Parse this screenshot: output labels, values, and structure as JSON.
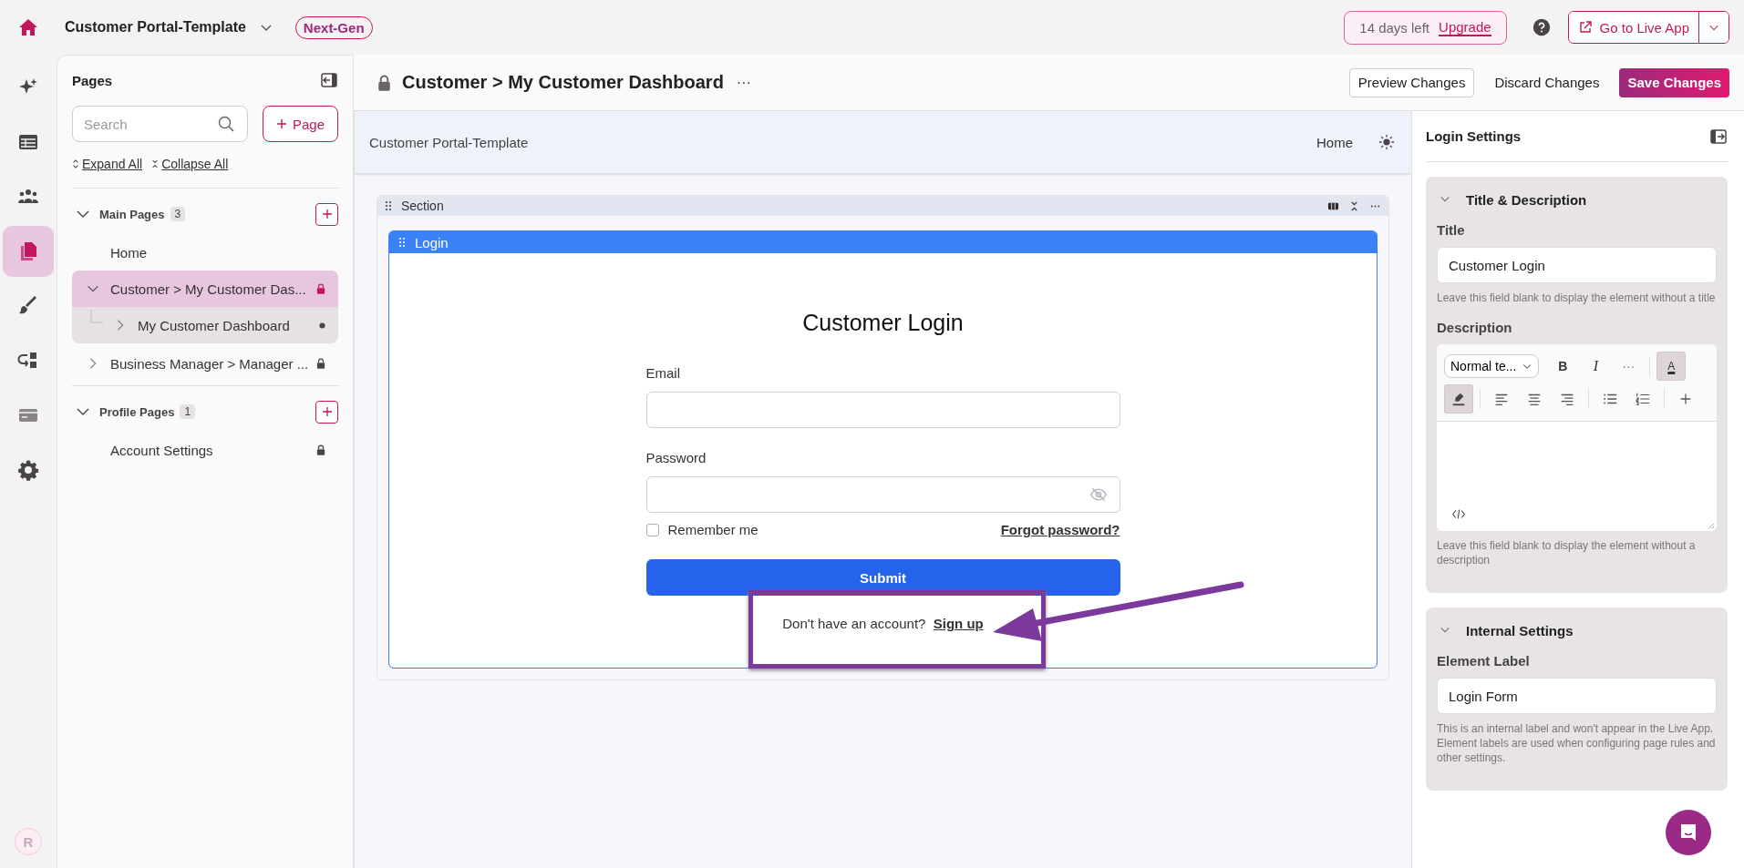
{
  "app": {
    "name": "Customer Portal-Template",
    "badge": "Next-Gen"
  },
  "trial": {
    "text": "14 days left",
    "link": "Upgrade"
  },
  "live_button": {
    "label": "Go to Live App"
  },
  "rail": [
    {
      "kind": "sparkles",
      "selected": false
    },
    {
      "kind": "table",
      "selected": false
    },
    {
      "kind": "users",
      "selected": false
    },
    {
      "kind": "pages",
      "selected": true
    },
    {
      "kind": "brush",
      "selected": false
    },
    {
      "kind": "flow",
      "selected": false
    },
    {
      "kind": "card",
      "selected": false
    },
    {
      "kind": "gear",
      "selected": false
    }
  ],
  "avatar": "R",
  "pages_panel": {
    "title": "Pages",
    "search": {
      "placeholder": "Search"
    },
    "add_button": "Page",
    "expand": "Expand All",
    "collapse": "Collapse All",
    "groups": [
      {
        "title": "Main Pages",
        "count": "3",
        "expanded": true,
        "items": [
          {
            "label": "Home",
            "kind": "page",
            "selected": false,
            "locked": false
          },
          {
            "label": "Customer > My Customer Das...",
            "kind": "folder",
            "expanded": true,
            "selected": true,
            "locked": true,
            "children": [
              {
                "label": "My Customer Dashboard",
                "kind": "folder",
                "expanded": false,
                "selected": false,
                "locked": false
              }
            ]
          },
          {
            "label": "Business Manager > Manager ...",
            "kind": "folder",
            "expanded": false,
            "selected": false,
            "locked": true
          }
        ]
      },
      {
        "title": "Profile Pages",
        "count": "1",
        "expanded": true,
        "items": [
          {
            "label": "Account Settings",
            "kind": "page",
            "selected": false,
            "locked": true
          }
        ]
      }
    ]
  },
  "page_header": {
    "title": "Customer > My Customer Dashboard",
    "locked": true,
    "more": "···",
    "actions": [
      {
        "label": "Preview Changes",
        "kind": "outline"
      },
      {
        "label": "Discard Changes",
        "kind": "plain"
      },
      {
        "label": "Save Changes",
        "kind": "primary"
      }
    ]
  },
  "canvas": {
    "breadcrumb": "Customer Portal-Template",
    "nav": "Home",
    "section": "Section",
    "element": "Login",
    "form": {
      "title": "Customer Login",
      "fields": [
        {
          "label": "Email",
          "kind": "text"
        },
        {
          "label": "Password",
          "kind": "password"
        }
      ],
      "remember": {
        "label": "Remember me",
        "checked": false
      },
      "forgot": "Forgot password?",
      "submit": "Submit",
      "signup_text": "Don't have an account?",
      "signup_link": "Sign up"
    }
  },
  "settings": {
    "title": "Login Settings",
    "title_panel": {
      "heading": "Title & Description",
      "expanded": true,
      "title_label": "Title",
      "title_value": "Customer Login",
      "title_help": "Leave this field blank to display the element without a title",
      "desc_label": "Description",
      "toolbar_rows": [
        [
          {
            "kind": "select",
            "label": "Normal te..."
          },
          {
            "kind": "bold",
            "label": "B",
            "active": false
          },
          {
            "kind": "italic",
            "label": "I",
            "active": false
          },
          {
            "kind": "more",
            "label": "···",
            "active": false
          },
          {
            "kind": "sep"
          },
          {
            "kind": "color",
            "label": "A",
            "active": true
          }
        ],
        [
          {
            "kind": "highlight",
            "active": true
          },
          {
            "kind": "sep"
          },
          {
            "kind": "align-left",
            "active": false
          },
          {
            "kind": "align-center",
            "active": false
          },
          {
            "kind": "align-right",
            "active": false
          },
          {
            "kind": "sep"
          },
          {
            "kind": "bullets",
            "active": false
          },
          {
            "kind": "numbered",
            "active": false
          },
          {
            "kind": "sep"
          },
          {
            "kind": "plus",
            "active": false
          }
        ]
      ],
      "desc_help": "Leave this field blank to display the element without a description"
    },
    "internal_panel": {
      "heading": "Internal Settings",
      "expanded": true,
      "label": "Element Label",
      "value": "Login Form",
      "help": "This is an internal label and won't appear in the Live App. Element labels are used when configuring page rules and other settings."
    }
  }
}
